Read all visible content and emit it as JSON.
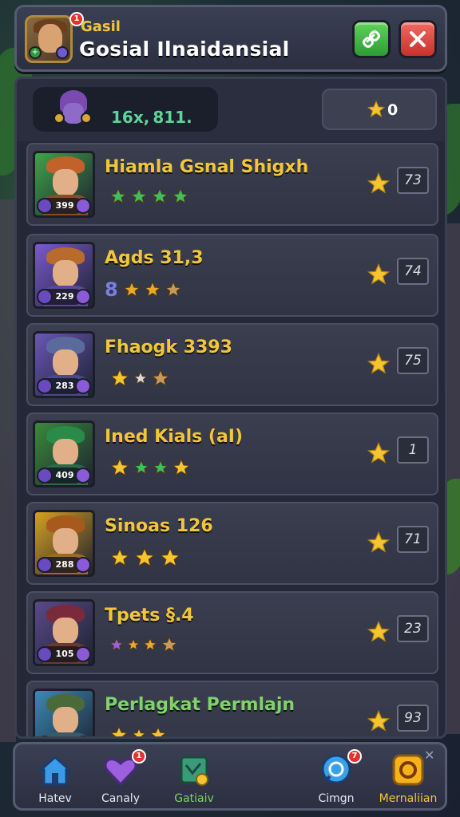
{
  "header": {
    "subtitle": "Gasil",
    "title": "Gosial Ilnaidansial",
    "avatar_notification": "1"
  },
  "player": {
    "code": "16х, 811.",
    "stars": "0"
  },
  "rows": [
    {
      "name": "Hiamla Gsnal Shigxh",
      "level": "399",
      "prefix": "",
      "count": "73",
      "colors": {
        "frame": "#3fa34a",
        "hair": "#c0622a",
        "body": "#8a4a2a"
      }
    },
    {
      "name": "Agds 31,3",
      "level": "229",
      "prefix": "8",
      "count": "74",
      "colors": {
        "frame": "#7a5ad0",
        "hair": "#b86b2a",
        "body": "#5a4a9a"
      }
    },
    {
      "name": "Fhaogk 3393",
      "level": "283",
      "prefix": "",
      "count": "75",
      "colors": {
        "frame": "#6a56b8",
        "hair": "#5a6a9a",
        "body": "#4a4a8a"
      }
    },
    {
      "name": "Ined Kials (aI)",
      "level": "409",
      "prefix": "",
      "count": "1",
      "colors": {
        "frame": "#3a8a3a",
        "hair": "#2a8a4a",
        "body": "#2a6a4a"
      }
    },
    {
      "name": "Sinoas 126",
      "level": "288",
      "prefix": "",
      "count": "71",
      "colors": {
        "frame": "#d8a020",
        "hair": "#a85a1e",
        "body": "#9a6a2a"
      }
    },
    {
      "name": "Tpets §.4",
      "level": "105",
      "prefix": "",
      "count": "23",
      "colors": {
        "frame": "#5a4a8a",
        "hair": "#7a2a3a",
        "body": "#6a3a2a"
      }
    },
    {
      "name": "Perlagkat Permlajn",
      "level": "",
      "prefix": "",
      "count": "93",
      "colors": {
        "frame": "#3a8ab8",
        "hair": "#4a6a3a",
        "body": "#3a5a6a"
      }
    }
  ],
  "nav": [
    {
      "label": "Hatev",
      "icon": "home-icon",
      "badge": ""
    },
    {
      "label": "Canaly",
      "icon": "heart-icon",
      "badge": "1"
    },
    {
      "label": "Gatiaiv",
      "icon": "map-icon",
      "badge": ""
    },
    {
      "label": "Cimgn",
      "icon": "chat-icon",
      "badge": "7"
    },
    {
      "label": "Mernaliian",
      "icon": "ring-icon",
      "badge": ""
    }
  ],
  "colors": {
    "gold": "#f1c63a",
    "green": "#5fd35a",
    "red": "#e4332c"
  }
}
